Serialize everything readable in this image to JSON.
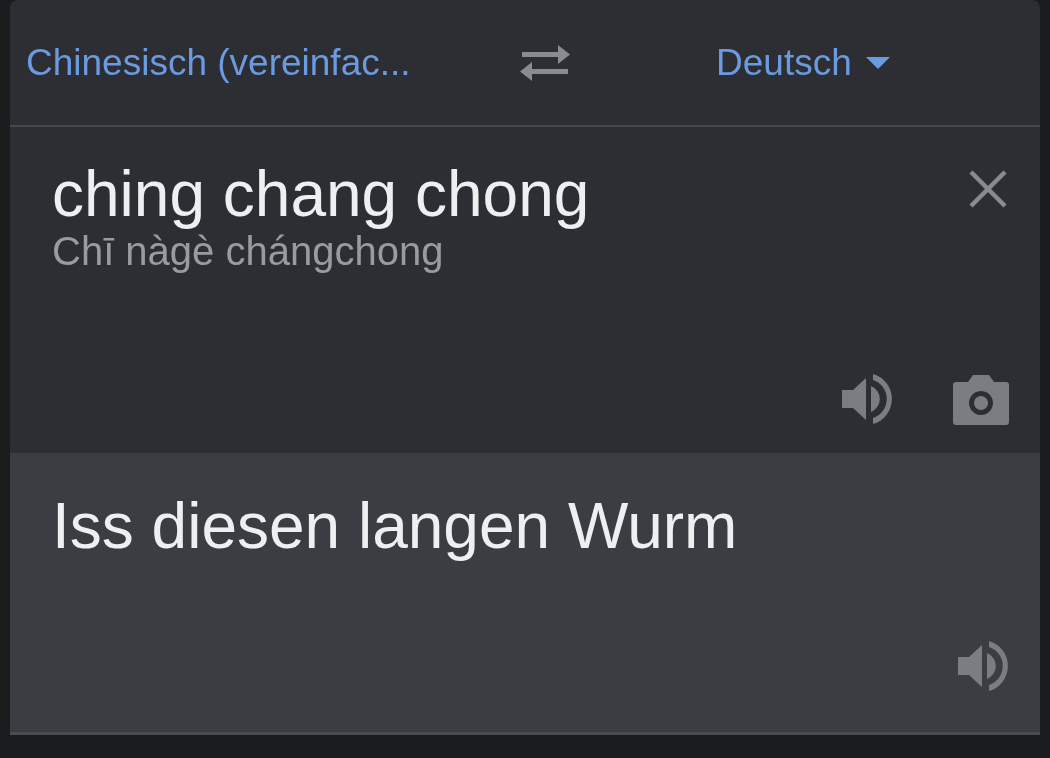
{
  "language_bar": {
    "source_language": "Chinesisch (vereinfac...",
    "target_language": "Deutsch"
  },
  "input": {
    "text": "ching chang chong",
    "transliteration": "Chī nàgè chángchong"
  },
  "output": {
    "text": "Iss diesen langen Wurm"
  }
}
